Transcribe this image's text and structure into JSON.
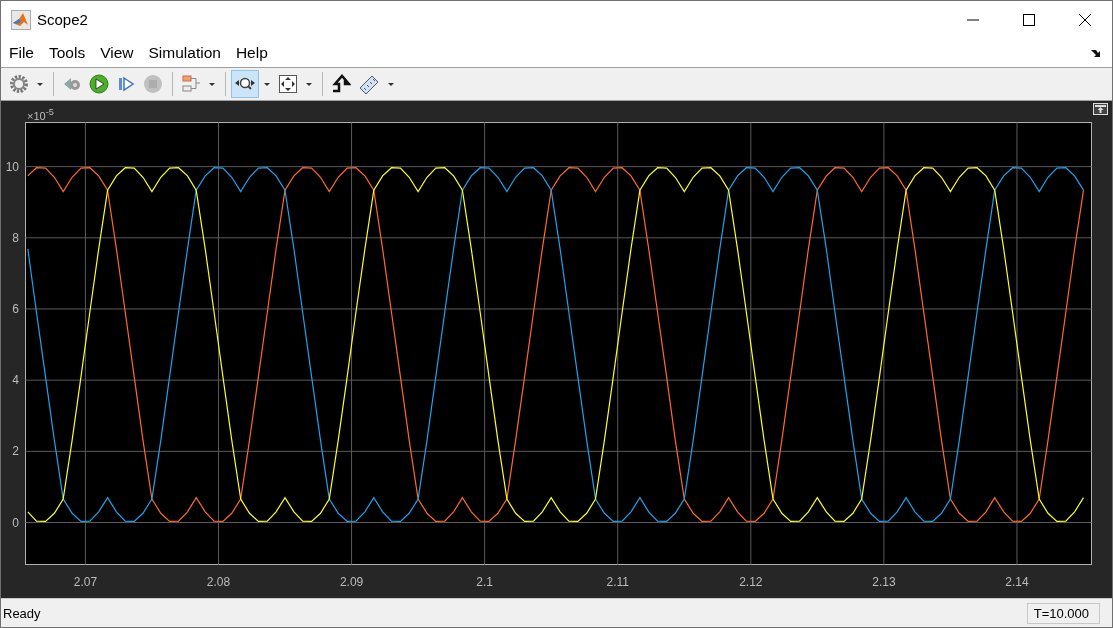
{
  "window": {
    "title": "Scope2"
  },
  "menu": [
    "File",
    "Tools",
    "View",
    "Simulation",
    "Help"
  ],
  "toolbar": {
    "groups": [
      [
        {
          "kind": "gear",
          "dropdown": true,
          "selected": false,
          "disabled": false
        }
      ],
      [
        {
          "kind": "step-back",
          "dropdown": false,
          "selected": false,
          "disabled": false
        },
        {
          "kind": "run",
          "dropdown": false,
          "selected": false,
          "disabled": false
        },
        {
          "kind": "step-forward",
          "dropdown": false,
          "selected": false,
          "disabled": false
        },
        {
          "kind": "stop",
          "dropdown": false,
          "selected": false,
          "disabled": true
        }
      ],
      [
        {
          "kind": "layout",
          "dropdown": true,
          "selected": false,
          "disabled": false
        }
      ],
      [
        {
          "kind": "zoom-x",
          "dropdown": true,
          "selected": true,
          "disabled": false
        },
        {
          "kind": "fit",
          "dropdown": true,
          "selected": false,
          "disabled": false
        }
      ],
      [
        {
          "kind": "triggers",
          "dropdown": false,
          "selected": false,
          "disabled": false
        },
        {
          "kind": "ruler",
          "dropdown": true,
          "selected": false,
          "disabled": false
        }
      ]
    ]
  },
  "plot": {
    "y_exponent": "×10$^{-5}$",
    "chart_data": {
      "type": "line",
      "grid": true,
      "xlim": [
        2.0655,
        2.1456
      ],
      "ylim": [
        -1.18,
        11.24
      ],
      "xticks": [
        2.07,
        2.08,
        2.09,
        2.1,
        2.11,
        2.12,
        2.13,
        2.14
      ],
      "yticks": [
        0,
        2,
        4,
        6,
        8,
        10
      ],
      "x": [
        2.06567,
        2.06633,
        2.067,
        2.06767,
        2.06833,
        2.069,
        2.06967,
        2.07033,
        2.071,
        2.07167,
        2.07233,
        2.073,
        2.07367,
        2.07433,
        2.075,
        2.07567,
        2.07633,
        2.077,
        2.07767,
        2.07833,
        2.079,
        2.07967,
        2.08033,
        2.081,
        2.08167,
        2.08233,
        2.083,
        2.08367,
        2.08433,
        2.085,
        2.08567,
        2.08633,
        2.087,
        2.08767,
        2.08833,
        2.089,
        2.08967,
        2.09033,
        2.091,
        2.09167,
        2.09233,
        2.093,
        2.09367,
        2.09433,
        2.095,
        2.09567,
        2.09633,
        2.097,
        2.09767,
        2.09833,
        2.099,
        2.09967,
        2.10033,
        2.101,
        2.10167,
        2.10233,
        2.103,
        2.10367,
        2.10433,
        2.105,
        2.10567,
        2.10633,
        2.107,
        2.10767,
        2.10833,
        2.109,
        2.10967,
        2.11033,
        2.111,
        2.11167,
        2.11233,
        2.113,
        2.11367,
        2.11433,
        2.115,
        2.11567,
        2.11633,
        2.117,
        2.11767,
        2.11833,
        2.119,
        2.11967,
        2.12033,
        2.121,
        2.12167,
        2.12233,
        2.123,
        2.12367,
        2.12433,
        2.125,
        2.12567,
        2.12633,
        2.127,
        2.12767,
        2.12833,
        2.129,
        2.12967,
        2.13033,
        2.131,
        2.13167,
        2.13233,
        2.133,
        2.13367,
        2.13433,
        2.135,
        2.13567,
        2.13633,
        2.137,
        2.13767,
        2.13833,
        2.139,
        2.13967,
        2.14033,
        2.141,
        2.14167,
        2.14233,
        2.143,
        2.14367,
        2.14433,
        2.145
      ],
      "series": [
        {
          "color": "#ff6a2a",
          "values": [
            9.74,
            9.97,
            9.96,
            9.7,
            9.3,
            9.7,
            9.96,
            9.97,
            9.74,
            9.34,
            7.69,
            5.9,
            4.1,
            2.31,
            0.66,
            0.26,
            0.03,
            0.04,
            0.3,
            0.7,
            0.3,
            0.04,
            0.03,
            0.26,
            0.66,
            2.31,
            4.1,
            5.9,
            7.69,
            9.34,
            9.74,
            9.97,
            9.96,
            9.7,
            9.3,
            9.7,
            9.96,
            9.97,
            9.74,
            9.34,
            7.69,
            5.9,
            4.1,
            2.31,
            0.66,
            0.26,
            0.03,
            0.04,
            0.3,
            0.7,
            0.3,
            0.04,
            0.03,
            0.26,
            0.66,
            2.31,
            4.1,
            5.9,
            7.69,
            9.34,
            9.74,
            9.97,
            9.96,
            9.7,
            9.3,
            9.7,
            9.96,
            9.97,
            9.74,
            9.34,
            7.69,
            5.9,
            4.1,
            2.31,
            0.66,
            0.26,
            0.03,
            0.04,
            0.3,
            0.7,
            0.3,
            0.04,
            0.03,
            0.26,
            0.66,
            2.31,
            4.1,
            5.9,
            7.69,
            9.34,
            9.74,
            9.97,
            9.96,
            9.7,
            9.3,
            9.7,
            9.96,
            9.97,
            9.74,
            9.34,
            7.69,
            5.9,
            4.1,
            2.31,
            0.66,
            0.26,
            0.03,
            0.04,
            0.3,
            0.7,
            0.3,
            0.04,
            0.03,
            0.26,
            0.66,
            2.31,
            4.1,
            5.9,
            7.69,
            9.34
          ]
        },
        {
          "color": "#1fa3ef",
          "values": [
            7.69,
            5.9,
            4.1,
            2.31,
            0.66,
            0.26,
            0.03,
            0.04,
            0.3,
            0.7,
            0.3,
            0.04,
            0.03,
            0.26,
            0.66,
            2.31,
            4.1,
            5.9,
            7.69,
            9.34,
            9.74,
            9.97,
            9.96,
            9.7,
            9.3,
            9.7,
            9.96,
            9.97,
            9.74,
            9.34,
            7.69,
            5.9,
            4.1,
            2.31,
            0.66,
            0.26,
            0.03,
            0.04,
            0.3,
            0.7,
            0.3,
            0.04,
            0.03,
            0.26,
            0.66,
            2.31,
            4.1,
            5.9,
            7.69,
            9.34,
            9.74,
            9.97,
            9.96,
            9.7,
            9.3,
            9.7,
            9.96,
            9.97,
            9.74,
            9.34,
            7.69,
            5.9,
            4.1,
            2.31,
            0.66,
            0.26,
            0.03,
            0.04,
            0.3,
            0.7,
            0.3,
            0.04,
            0.03,
            0.26,
            0.66,
            2.31,
            4.1,
            5.9,
            7.69,
            9.34,
            9.74,
            9.97,
            9.96,
            9.7,
            9.3,
            9.7,
            9.96,
            9.97,
            9.74,
            9.34,
            7.69,
            5.9,
            4.1,
            2.31,
            0.66,
            0.26,
            0.03,
            0.04,
            0.3,
            0.7,
            0.3,
            0.04,
            0.03,
            0.26,
            0.66,
            2.31,
            4.1,
            5.9,
            7.69,
            9.34,
            9.74,
            9.97,
            9.96,
            9.7,
            9.3,
            9.7,
            9.96,
            9.97,
            9.74,
            9.34
          ]
        },
        {
          "color": "#ffff22",
          "values": [
            0.3,
            0.04,
            0.03,
            0.26,
            0.66,
            2.31,
            4.1,
            5.9,
            7.69,
            9.34,
            9.74,
            9.97,
            9.96,
            9.7,
            9.3,
            9.7,
            9.96,
            9.97,
            9.74,
            9.34,
            7.69,
            5.9,
            4.1,
            2.31,
            0.66,
            0.26,
            0.03,
            0.04,
            0.3,
            0.7,
            0.3,
            0.04,
            0.03,
            0.26,
            0.66,
            2.31,
            4.1,
            5.9,
            7.69,
            9.34,
            9.74,
            9.97,
            9.96,
            9.7,
            9.3,
            9.7,
            9.96,
            9.97,
            9.74,
            9.34,
            7.69,
            5.9,
            4.1,
            2.31,
            0.66,
            0.26,
            0.03,
            0.04,
            0.3,
            0.7,
            0.3,
            0.04,
            0.03,
            0.26,
            0.66,
            2.31,
            4.1,
            5.9,
            7.69,
            9.34,
            9.74,
            9.97,
            9.96,
            9.7,
            9.3,
            9.7,
            9.96,
            9.97,
            9.74,
            9.34,
            7.69,
            5.9,
            4.1,
            2.31,
            0.66,
            0.26,
            0.03,
            0.04,
            0.3,
            0.7,
            0.3,
            0.04,
            0.03,
            0.26,
            0.66,
            2.31,
            4.1,
            5.9,
            7.69,
            9.34,
            9.74,
            9.97,
            9.96,
            9.7,
            9.3,
            9.7,
            9.96,
            9.97,
            9.74,
            9.34,
            7.69,
            5.9,
            4.1,
            2.31,
            0.66,
            0.26,
            0.03,
            0.04,
            0.3,
            0.7
          ]
        }
      ]
    }
  },
  "status_bar": {
    "text": "Ready",
    "time": "T=10.000"
  }
}
